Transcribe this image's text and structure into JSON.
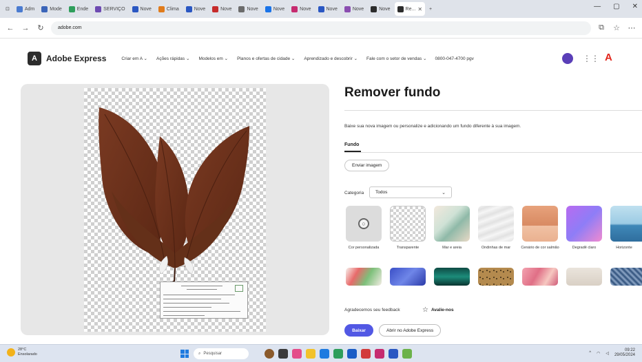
{
  "browser": {
    "tabs": [
      {
        "label": "Adm",
        "color": "#4a7bd0"
      },
      {
        "label": "Mode",
        "color": "#3a64b8"
      },
      {
        "label": "Ende",
        "color": "#2e9e5b"
      },
      {
        "label": "SERVIÇO",
        "color": "#6d4ab2"
      },
      {
        "label": "Nove",
        "color": "#2a57c2"
      },
      {
        "label": "Clima",
        "color": "#e07b1b"
      },
      {
        "label": "Nove",
        "color": "#2a57c2"
      },
      {
        "label": "Nove",
        "color": "#c62b2b"
      },
      {
        "label": "Nove",
        "color": "#6b6b6b"
      },
      {
        "label": "Nove",
        "color": "#1a73e8"
      },
      {
        "label": "Nove",
        "color": "#c62b6f"
      },
      {
        "label": "Nove",
        "color": "#2a57c2"
      },
      {
        "label": "Nove",
        "color": "#8a4db0"
      },
      {
        "label": "Nove",
        "color": "#2c2c2c"
      }
    ],
    "active_tab": {
      "label": "Re..."
    },
    "url_host": "adobe.com"
  },
  "header": {
    "logo_letter": "A",
    "brand": "Adobe Express",
    "nav": [
      "Criar em A ⌄",
      "Ações rápidas ⌄",
      "Modelos em ⌄",
      "Planos e ofertas de cidade ⌄",
      "Aprendizado e descobrir ⌄",
      "Fale com o setor de vendas ⌄"
    ],
    "phone": "0800-047-4700 pgv"
  },
  "panel": {
    "title": "Remover fundo",
    "description": "Baixe sua nova imagem ou personalize e adicionando um fundo diferente à sua imagem.",
    "tab_label": "Fundo",
    "upload_label": "Enviar imagem",
    "category_label": "Categoria",
    "category_value": "Todos",
    "backgrounds": [
      {
        "label": "Cor personalizada"
      },
      {
        "label": "Transparente"
      },
      {
        "label": "Mar e areia"
      },
      {
        "label": "Ondinhas de mar"
      },
      {
        "label": "Cenário de cor salmão"
      },
      {
        "label": "Degradê claro"
      },
      {
        "label": "Horizonte"
      }
    ],
    "feedback_label": "Agradecemos seu feedback",
    "rate_label": "Avalie-nos",
    "save_label": "Baixar",
    "open_label": "Abrir no Adobe Express"
  },
  "taskbar": {
    "weather_temp": "28°C",
    "weather_desc": "Ensolarado",
    "search_placeholder": "Pesquisar",
    "clock_time": "09:22",
    "clock_date": "29/05/2024"
  }
}
